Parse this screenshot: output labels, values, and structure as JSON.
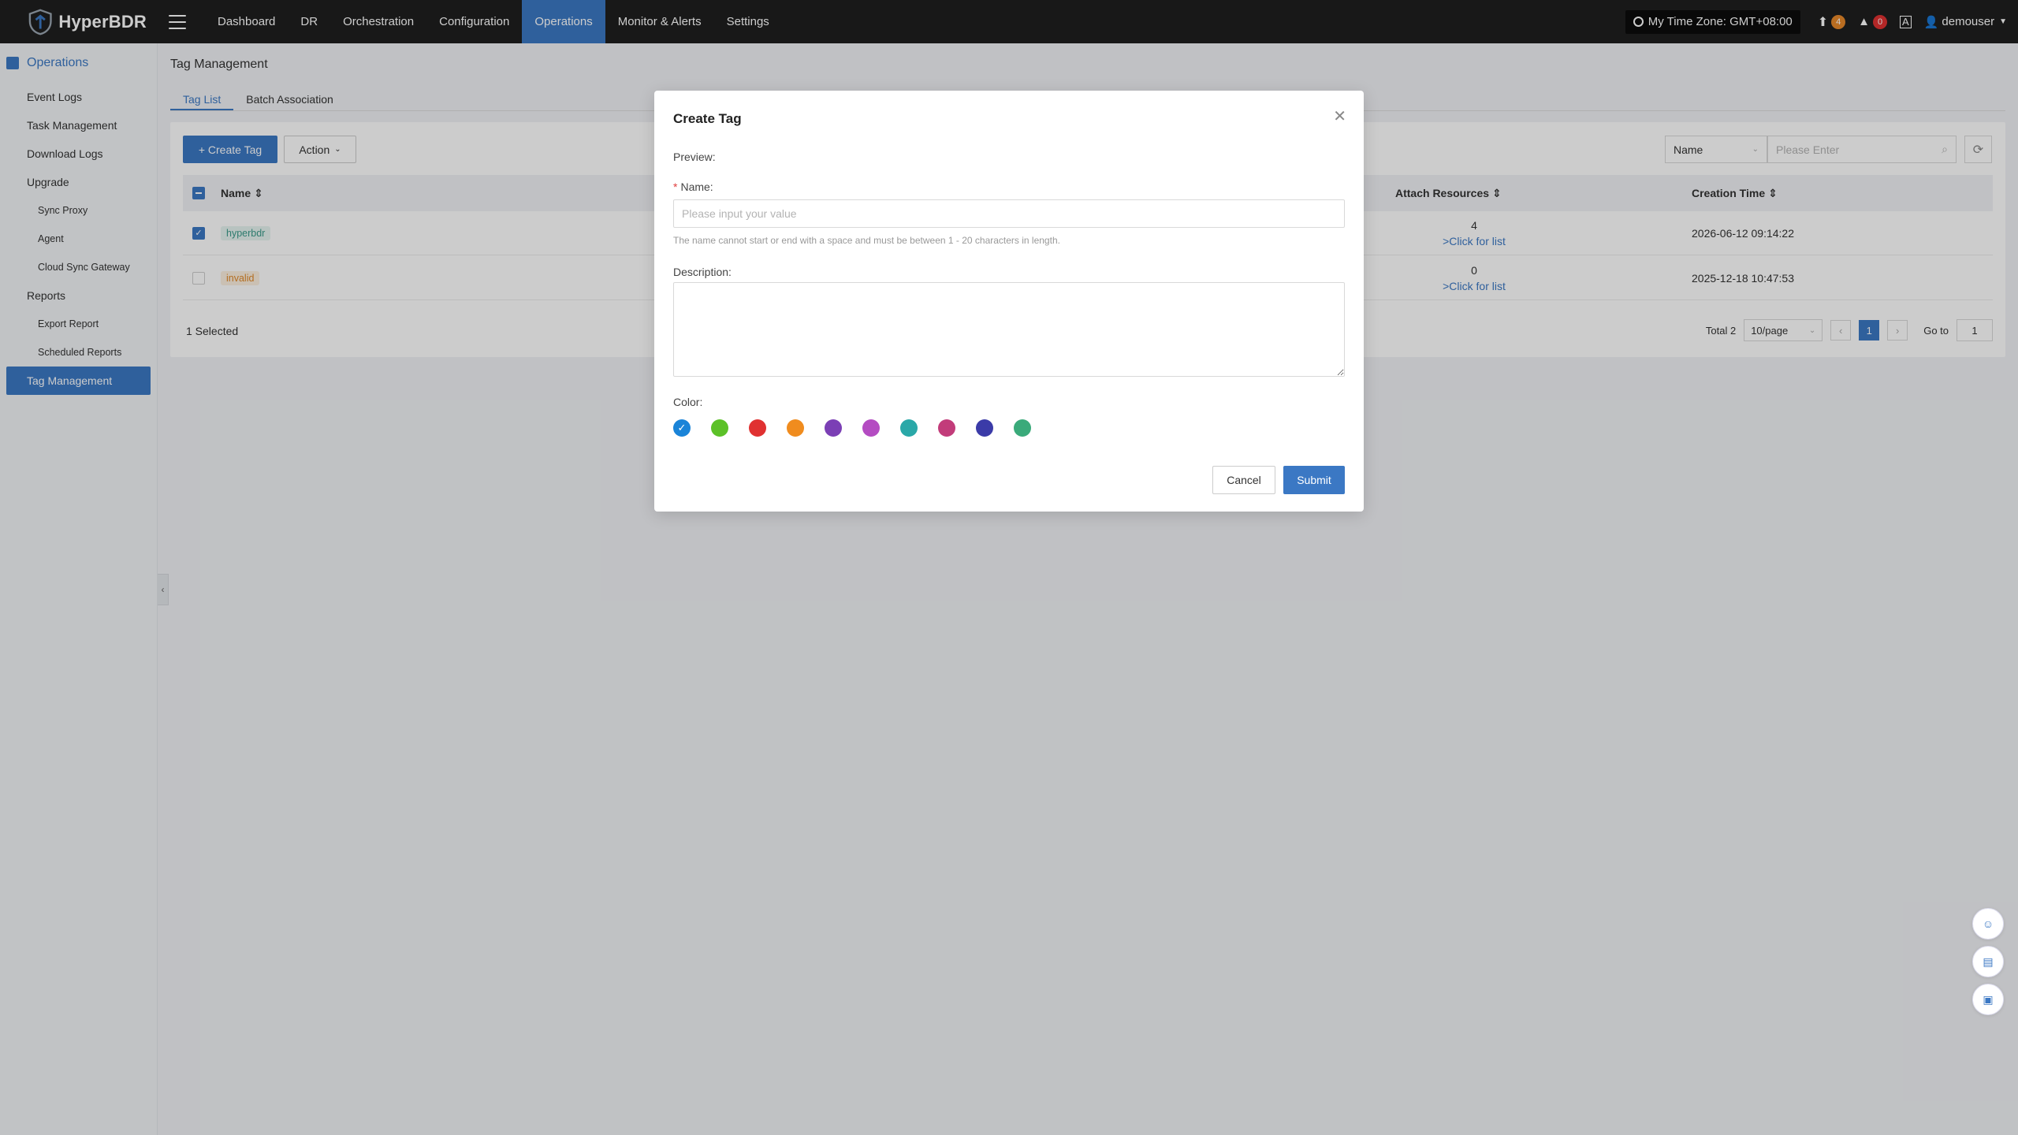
{
  "app": {
    "logo_text": "HyperBDR"
  },
  "nav": {
    "items": [
      "Dashboard",
      "DR",
      "Orchestration",
      "Configuration",
      "Operations",
      "Monitor & Alerts",
      "Settings"
    ],
    "active": "Operations"
  },
  "top_right": {
    "timezone": "My Time Zone: GMT+08:00",
    "upload_count": "4",
    "alert_count": "0",
    "username": "demouser"
  },
  "sidebar": {
    "header": "Operations",
    "items": [
      {
        "label": "Event Logs",
        "level": 1
      },
      {
        "label": "Task Management",
        "level": 1
      },
      {
        "label": "Download Logs",
        "level": 1
      },
      {
        "label": "Upgrade",
        "level": 1
      },
      {
        "label": "Sync Proxy",
        "level": 2
      },
      {
        "label": "Agent",
        "level": 2
      },
      {
        "label": "Cloud Sync Gateway",
        "level": 2
      },
      {
        "label": "Reports",
        "level": 1
      },
      {
        "label": "Export Report",
        "level": 2
      },
      {
        "label": "Scheduled Reports",
        "level": 2
      },
      {
        "label": "Tag Management",
        "level": 1,
        "active": true
      }
    ]
  },
  "page": {
    "title": "Tag Management",
    "tabs": [
      "Tag List",
      "Batch Association"
    ]
  },
  "toolbar": {
    "create_label": "+ Create Tag",
    "action_label": "Action",
    "filter_field": "Name",
    "search_placeholder": "Please Enter"
  },
  "table": {
    "columns": {
      "name": "Name ⇕",
      "attach": "Attach Resources ⇕",
      "created": "Creation Time ⇕"
    },
    "rows": [
      {
        "name": "hyperbdr",
        "tag_bg": "#e6f4f1",
        "tag_fg": "#3b9b8a",
        "checked": true,
        "count": "4",
        "link": ">Click for list",
        "created": "2026-06-12 09:14:22"
      },
      {
        "name": "invalid",
        "tag_bg": "#fdf0e0",
        "tag_fg": "#e0892a",
        "checked": false,
        "count": "0",
        "link": ">Click for list",
        "created": "2025-12-18 10:47:53"
      }
    ],
    "selected_text": "1 Selected"
  },
  "pagination": {
    "total": "Total 2",
    "page_size": "10/page",
    "current": "1",
    "goto_label": "Go to",
    "goto_value": "1"
  },
  "modal": {
    "title": "Create Tag",
    "preview_label": "Preview:",
    "name_label": "Name:",
    "name_placeholder": "Please input your value",
    "name_hint": "The name cannot start or end with a space and must be between 1 - 20 characters in length.",
    "description_label": "Description:",
    "color_label": "Color:",
    "colors": [
      "#1a84d8",
      "#5cc128",
      "#e03131",
      "#f08c1e",
      "#7b3fb5",
      "#b44cc2",
      "#2aa8a8",
      "#c23c7a",
      "#3b3ba8",
      "#3aaa7a"
    ],
    "selected_color_index": 0,
    "cancel_label": "Cancel",
    "submit_label": "Submit"
  },
  "colors": {
    "accent": "#3b78c4",
    "topbar": "#1f1f1f",
    "upload_badge": "#e8892a",
    "alert_badge": "#e03131"
  }
}
